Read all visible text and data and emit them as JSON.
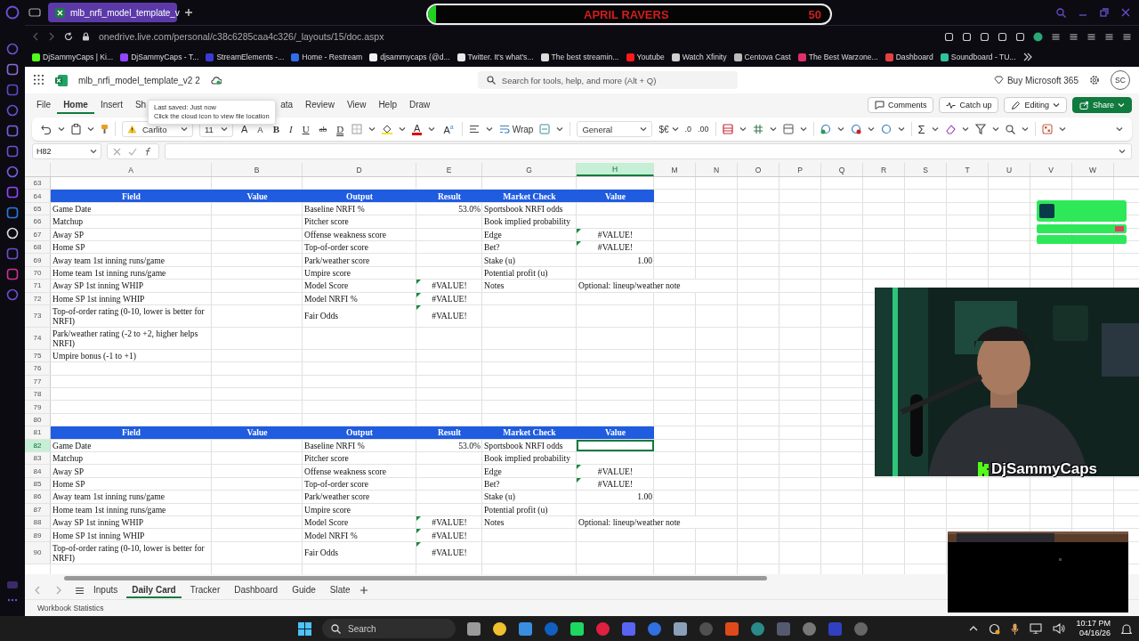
{
  "browser": {
    "tabs": [
      {
        "title": "mlb_nrfi_model_template_v",
        "selected": true
      }
    ],
    "address": "onedrive.live.com/personal/c38c6285caa4c326/_layouts/15/doc.aspx",
    "bookmarks": [
      {
        "label": "DjSammyCaps | Ki...",
        "color": "#53fc18"
      },
      {
        "label": "DjSammyCaps - T...",
        "color": "#9146ff"
      },
      {
        "label": "StreamElements -...",
        "color": "#3b3bd6"
      },
      {
        "label": "Home - Restream",
        "color": "#2f6fe8"
      },
      {
        "label": "djsammycaps (@d...",
        "color": "#f0f0f0"
      },
      {
        "label": "Twitter. It's what's...",
        "color": "#e8e8e8"
      },
      {
        "label": "The best streamin...",
        "color": "#dddddd"
      },
      {
        "label": "Youtube",
        "color": "#ff1a1a"
      },
      {
        "label": "Watch Xfinity",
        "color": "#cfcfcf"
      },
      {
        "label": "Centova Cast",
        "color": "#bbbbbb"
      },
      {
        "label": "The Best Warzone...",
        "color": "#e0306a"
      },
      {
        "label": "Dashboard",
        "color": "#e84040"
      },
      {
        "label": "Soundboard - TU...",
        "color": "#2fc4a0"
      }
    ]
  },
  "stream_goal": {
    "title": "APRIL RAVERS",
    "count": "50",
    "level": 0.02
  },
  "app": {
    "file_name": "mlb_nrfi_model_template_v2 2",
    "search": {
      "placeholder": "Search for tools, help, and more (Alt + Q)"
    },
    "buy": "Buy Microsoft 365",
    "avatar": "SC"
  },
  "tooltip": {
    "lines": [
      "Last saved: Just now",
      "Click the cloud icon to view file location"
    ]
  },
  "ribbon_tabs": [
    {
      "label": "File",
      "selected": false
    },
    {
      "label": "Home",
      "selected": true
    },
    {
      "label": "Insert",
      "selected": false
    },
    {
      "label": "Sh",
      "selected": false
    },
    {
      "label": "ata",
      "selected": false
    },
    {
      "label": "Review",
      "selected": false
    },
    {
      "label": "View",
      "selected": false
    },
    {
      "label": "Help",
      "selected": false
    },
    {
      "label": "Draw",
      "selected": false
    }
  ],
  "ribbon_buttons": [
    {
      "label": "Comments",
      "kind": "comments"
    },
    {
      "label": "Catch up",
      "kind": "catchup"
    },
    {
      "label": "Editing",
      "kind": "editing"
    },
    {
      "label": "Share",
      "kind": "share"
    }
  ],
  "toolbar": {
    "font": "Carlito",
    "size": "11",
    "format_buttons": [
      {
        "label": "A",
        "kind": "grow"
      },
      {
        "label": "A",
        "kind": "shrink"
      },
      {
        "label": "B",
        "kind": "bold"
      },
      {
        "label": "I",
        "kind": "italic"
      },
      {
        "label": "U",
        "kind": "underline"
      },
      {
        "label": "ab",
        "kind": "strike"
      },
      {
        "label": "D",
        "kind": "double"
      }
    ],
    "color_buttons": [
      {
        "label": "A",
        "kind": "color"
      },
      {
        "label": "A$^{a}$",
        "kind": "effects"
      }
    ],
    "wrap": "Wrap",
    "number_format": "General",
    "currency": "$€",
    "decimals": [
      ".0",
      ".00"
    ],
    "sum": "Σ"
  },
  "formula_bar": {
    "name_box": "H82"
  },
  "columns": [
    {
      "label": "A",
      "selected": false
    },
    {
      "label": "B",
      "selected": false
    },
    {
      "label": "D",
      "selected": false
    },
    {
      "label": "E",
      "selected": false
    },
    {
      "label": "G",
      "selected": false
    },
    {
      "label": "H",
      "selected": true
    },
    {
      "label": "M",
      "selected": false
    },
    {
      "label": "N",
      "selected": false
    },
    {
      "label": "O",
      "selected": false
    },
    {
      "label": "P",
      "selected": false
    },
    {
      "label": "Q",
      "selected": false
    },
    {
      "label": "R",
      "selected": false
    },
    {
      "label": "S",
      "selected": false
    },
    {
      "label": "T",
      "selected": false
    },
    {
      "label": "U",
      "selected": false
    },
    {
      "label": "V",
      "selected": false
    },
    {
      "label": "W",
      "selected": false
    }
  ],
  "rows": [
    {
      "number": "63",
      "selected": false,
      "kind": "data"
    },
    {
      "number": "64",
      "selected": false,
      "kind": "header",
      "cells": [
        {
          "text": "Field"
        },
        {
          "text": "Value"
        },
        {
          "text": "Output"
        },
        {
          "text": "Result"
        },
        {
          "text": "Market Check"
        },
        {
          "text": "Value"
        }
      ]
    },
    {
      "number": "65",
      "selected": false,
      "kind": "data",
      "cells": [
        {
          "text": "Game Date",
          "kind": "text"
        },
        null,
        {
          "text": "Baseline NRFI %",
          "kind": "text"
        },
        {
          "text": "53.0%",
          "kind": "number"
        },
        {
          "text": "Sportsbook NRFI odds",
          "kind": "text"
        },
        null
      ]
    },
    {
      "number": "66",
      "selected": false,
      "kind": "data",
      "cells": [
        {
          "text": "Matchup",
          "kind": "text"
        },
        null,
        {
          "text": "Pitcher score",
          "kind": "text"
        },
        null,
        {
          "text": "Book implied probability",
          "kind": "text"
        },
        null
      ]
    },
    {
      "number": "67",
      "selected": false,
      "kind": "data",
      "cells": [
        {
          "text": "Away SP",
          "kind": "text"
        },
        null,
        {
          "text": "Offense weakness score",
          "kind": "text"
        },
        null,
        {
          "text": "Edge",
          "kind": "text"
        },
        {
          "text": "#VALUE!",
          "kind": "error",
          "flagged": true
        }
      ]
    },
    {
      "number": "68",
      "selected": false,
      "kind": "data",
      "cells": [
        {
          "text": "Home SP",
          "kind": "text"
        },
        null,
        {
          "text": "Top-of-order score",
          "kind": "text"
        },
        null,
        {
          "text": "Bet?",
          "kind": "text"
        },
        {
          "text": "#VALUE!",
          "kind": "error",
          "flagged": true
        }
      ]
    },
    {
      "number": "69",
      "selected": false,
      "kind": "data",
      "cells": [
        {
          "text": "Away team 1st inning runs/game",
          "kind": "text"
        },
        null,
        {
          "text": "Park/weather score",
          "kind": "text"
        },
        null,
        {
          "text": "Stake (u)",
          "kind": "text"
        },
        {
          "text": "1.00",
          "kind": "number"
        }
      ]
    },
    {
      "number": "70",
      "selected": false,
      "kind": "data",
      "cells": [
        {
          "text": "Home team 1st inning runs/game",
          "kind": "text"
        },
        null,
        {
          "text": "Umpire score",
          "kind": "text"
        },
        null,
        {
          "text": "Potential profit (u)",
          "kind": "text"
        },
        null
      ]
    },
    {
      "number": "71",
      "selected": false,
      "kind": "data",
      "cells": [
        {
          "text": "Away SP 1st inning WHIP",
          "kind": "text"
        },
        null,
        {
          "text": "Model Score",
          "kind": "text"
        },
        {
          "text": "#VALUE!",
          "kind": "error",
          "flagged": true
        },
        {
          "text": "Notes",
          "kind": "text"
        },
        {
          "text": "Optional: lineup/weather note",
          "kind": "text"
        }
      ]
    },
    {
      "number": "72",
      "selected": false,
      "kind": "data",
      "cells": [
        {
          "text": "Home SP 1st inning WHIP",
          "kind": "text"
        },
        null,
        {
          "text": "Model NRFI %",
          "kind": "text"
        },
        {
          "text": "#VALUE!",
          "kind": "error",
          "flagged": true
        },
        null,
        null
      ]
    },
    {
      "number": "73",
      "selected": false,
      "kind": "data",
      "cells": [
        {
          "text": "Top-of-order rating (0-10, lower is better for NRFI)",
          "kind": "text"
        },
        null,
        {
          "text": "Fair Odds",
          "kind": "text"
        },
        {
          "text": "#VALUE!",
          "kind": "error",
          "flagged": true
        },
        null,
        null
      ]
    },
    {
      "number": "74",
      "selected": false,
      "kind": "data",
      "cells": [
        {
          "text": "Park/weather rating (-2 to +2, higher helps NRFI)",
          "kind": "text"
        },
        null,
        null,
        null,
        null,
        null
      ]
    },
    {
      "number": "75",
      "selected": false,
      "kind": "data",
      "cells": [
        {
          "text": "Umpire bonus (-1 to +1)",
          "kind": "text"
        },
        null,
        null,
        null,
        null,
        null
      ]
    },
    {
      "number": "76",
      "selected": false,
      "kind": "data"
    },
    {
      "number": "77",
      "selected": false,
      "kind": "data"
    },
    {
      "number": "78",
      "selected": false,
      "kind": "data"
    },
    {
      "number": "79",
      "selected": false,
      "kind": "data"
    },
    {
      "number": "80",
      "selected": false,
      "kind": "data"
    },
    {
      "number": "81",
      "selected": false,
      "kind": "header",
      "cells": [
        {
          "text": "Field"
        },
        {
          "text": "Value"
        },
        {
          "text": "Output"
        },
        {
          "text": "Result"
        },
        {
          "text": "Market Check"
        },
        {
          "text": "Value"
        }
      ]
    },
    {
      "number": "82",
      "selected": true,
      "kind": "data",
      "cells": [
        {
          "text": "Game Date",
          "kind": "text"
        },
        null,
        {
          "text": "Baseline NRFI %",
          "kind": "text"
        },
        {
          "text": "53.0%",
          "kind": "number"
        },
        {
          "text": "Sportsbook NRFI odds",
          "kind": "text"
        },
        null
      ]
    },
    {
      "number": "83",
      "selected": false,
      "kind": "data",
      "cells": [
        {
          "text": "Matchup",
          "kind": "text"
        },
        null,
        {
          "text": "Pitcher score",
          "kind": "text"
        },
        null,
        {
          "text": "Book implied probability",
          "kind": "text"
        },
        null
      ]
    },
    {
      "number": "84",
      "selected": false,
      "kind": "data",
      "cells": [
        {
          "text": "Away SP",
          "kind": "text"
        },
        null,
        {
          "text": "Offense weakness score",
          "kind": "text"
        },
        null,
        {
          "text": "Edge",
          "kind": "text"
        },
        {
          "text": "#VALUE!",
          "kind": "error",
          "flagged": true
        }
      ]
    },
    {
      "number": "85",
      "selected": false,
      "kind": "data",
      "cells": [
        {
          "text": "Home SP",
          "kind": "text"
        },
        null,
        {
          "text": "Top-of-order score",
          "kind": "text"
        },
        null,
        {
          "text": "Bet?",
          "kind": "text"
        },
        {
          "text": "#VALUE!",
          "kind": "error",
          "flagged": true
        }
      ]
    },
    {
      "number": "86",
      "selected": false,
      "kind": "data",
      "cells": [
        {
          "text": "Away team 1st inning runs/game",
          "kind": "text"
        },
        null,
        {
          "text": "Park/weather score",
          "kind": "text"
        },
        null,
        {
          "text": "Stake (u)",
          "kind": "text"
        },
        {
          "text": "1.00",
          "kind": "number"
        }
      ]
    },
    {
      "number": "87",
      "selected": false,
      "kind": "data",
      "cells": [
        {
          "text": "Home team 1st inning runs/game",
          "kind": "text"
        },
        null,
        {
          "text": "Umpire score",
          "kind": "text"
        },
        null,
        {
          "text": "Potential profit (u)",
          "kind": "text"
        },
        null
      ]
    },
    {
      "number": "88",
      "selected": false,
      "kind": "data",
      "cells": [
        {
          "text": "Away SP 1st inning WHIP",
          "kind": "text"
        },
        null,
        {
          "text": "Model Score",
          "kind": "text"
        },
        {
          "text": "#VALUE!",
          "kind": "error",
          "flagged": true
        },
        {
          "text": "Notes",
          "kind": "text"
        },
        {
          "text": "Optional: lineup/weather note",
          "kind": "text"
        }
      ]
    },
    {
      "number": "89",
      "selected": false,
      "kind": "data",
      "cells": [
        {
          "text": "Home SP 1st inning WHIP",
          "kind": "text"
        },
        null,
        {
          "text": "Model NRFI %",
          "kind": "text"
        },
        {
          "text": "#VALUE!",
          "kind": "error",
          "flagged": true
        },
        null,
        null
      ]
    },
    {
      "number": "90",
      "selected": false,
      "kind": "data",
      "cells": [
        {
          "text": "Top-of-order rating (0-10, lower is better for NRFI)",
          "kind": "text"
        },
        null,
        {
          "text": "Fair Odds",
          "kind": "text"
        },
        {
          "text": "#VALUE!",
          "kind": "error",
          "flagged": true
        },
        null,
        null
      ]
    }
  ],
  "sheets": [
    {
      "label": "Inputs",
      "selected": false
    },
    {
      "label": "Daily Card",
      "selected": true
    },
    {
      "label": "Tracker",
      "selected": false
    },
    {
      "label": "Dashboard",
      "selected": false
    },
    {
      "label": "Guide",
      "selected": false
    },
    {
      "label": "Slate",
      "selected": false
    }
  ],
  "status": "Workbook Statistics",
  "taskbar": {
    "search": "Search",
    "time": "10:17 PM",
    "date": "04/16/26"
  },
  "stream_overlay": {
    "name": "DjSammyCaps"
  }
}
